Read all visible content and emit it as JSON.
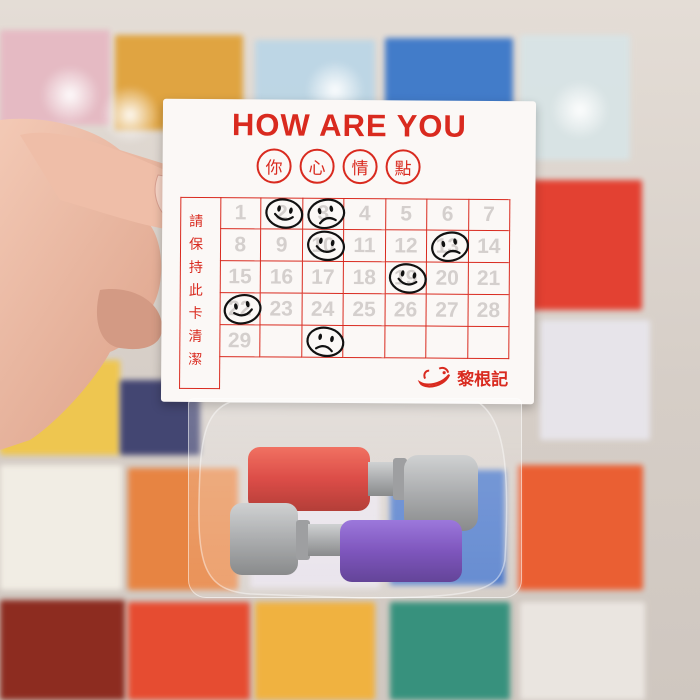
{
  "card": {
    "title": "HOW ARE YOU",
    "title_chars": [
      "你",
      "心",
      "情",
      "點"
    ],
    "side_chars": [
      "請",
      "保",
      "持",
      "此",
      "卡",
      "清",
      "潔"
    ],
    "grid_numbers": [
      "1",
      "2",
      "3",
      "4",
      "5",
      "6",
      "7",
      "8",
      "9",
      "10",
      "11",
      "12",
      "13",
      "14",
      "15",
      "16",
      "17",
      "18",
      "19",
      "20",
      "21",
      "22",
      "23",
      "24",
      "25",
      "26",
      "27",
      "28",
      "29",
      "",
      "",
      "",
      "",
      ""
    ],
    "brand_name": "黎根記",
    "stamps": [
      {
        "day": 2,
        "mood": "happy"
      },
      {
        "day": 3,
        "mood": "sad"
      },
      {
        "day": 10,
        "mood": "happy"
      },
      {
        "day": 13,
        "mood": "sad"
      },
      {
        "day": 19,
        "mood": "happy"
      },
      {
        "day": 22,
        "mood": "happy"
      },
      {
        "day": 31,
        "mood": "sad"
      }
    ]
  },
  "colors": {
    "card_red": "#d92a1f",
    "card_bg": "#fbf8f6",
    "stamp_red": "#d6302a",
    "stamp_purple": "#6a3bb3",
    "stamp_gray": "#9ea0a2"
  },
  "icons": {
    "brand": "banana-mascot-icon",
    "happy": "smiley-happy-icon",
    "sad": "smiley-sad-icon"
  }
}
